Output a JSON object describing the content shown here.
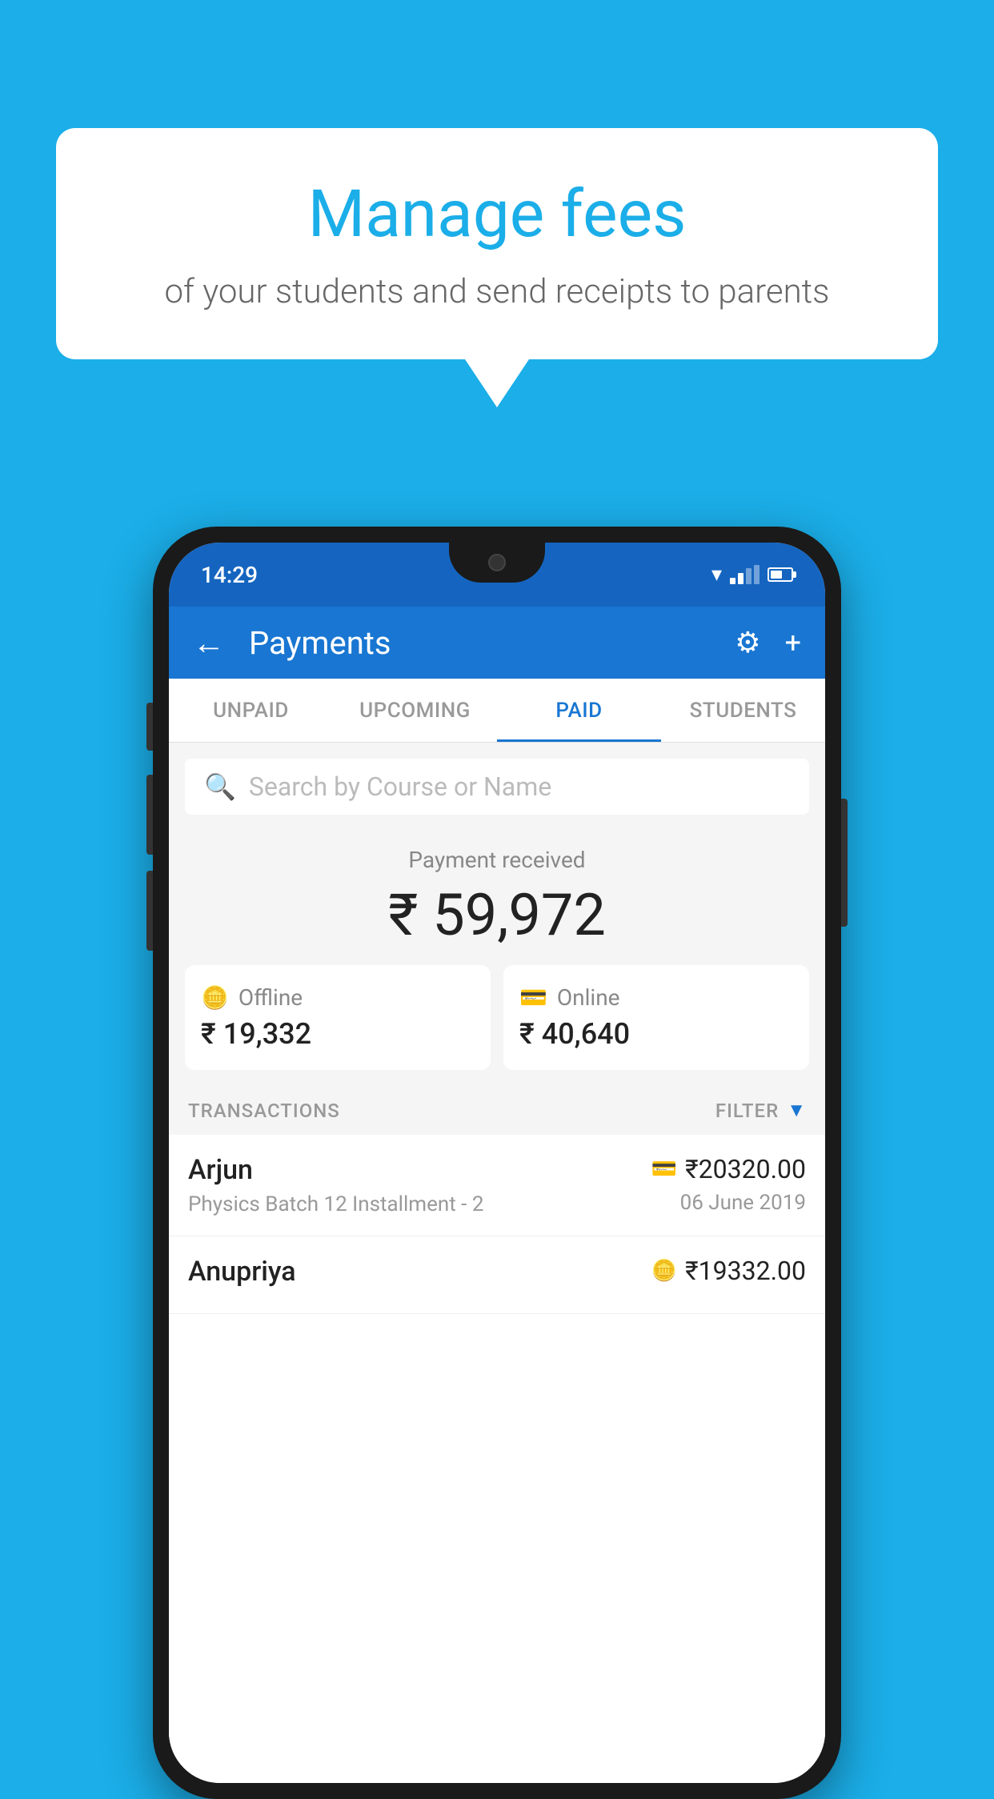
{
  "background_color": "#1BAEE8",
  "speech_bubble": {
    "title": "Manage fees",
    "subtitle": "of your students and send receipts to parents"
  },
  "status_bar": {
    "time": "14:29"
  },
  "header": {
    "title": "Payments",
    "back_label": "←"
  },
  "tabs": [
    {
      "label": "UNPAID",
      "active": false
    },
    {
      "label": "UPCOMING",
      "active": false
    },
    {
      "label": "PAID",
      "active": true
    },
    {
      "label": "STUDENTS",
      "active": false
    }
  ],
  "search": {
    "placeholder": "Search by Course or Name"
  },
  "payment_received": {
    "label": "Payment received",
    "amount": "₹ 59,972"
  },
  "payment_cards": [
    {
      "icon": "offline",
      "label": "Offline",
      "amount": "₹ 19,332"
    },
    {
      "icon": "online",
      "label": "Online",
      "amount": "₹ 40,640"
    }
  ],
  "transactions_section": {
    "label": "TRANSACTIONS",
    "filter_label": "FILTER"
  },
  "transactions": [
    {
      "name": "Arjun",
      "course": "Physics Batch 12 Installment - 2",
      "amount": "₹20320.00",
      "date": "06 June 2019",
      "payment_type": "card"
    },
    {
      "name": "Anupriya",
      "course": "",
      "amount": "₹19332.00",
      "date": "",
      "payment_type": "offline"
    }
  ]
}
